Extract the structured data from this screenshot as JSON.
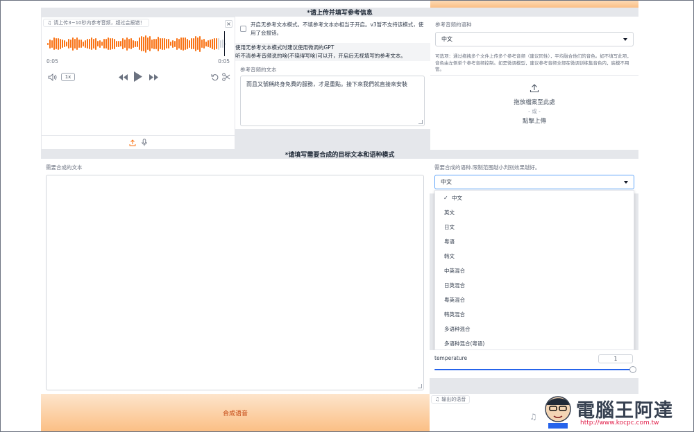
{
  "ref_section": {
    "title": "*请上传并填写参考信息"
  },
  "audio_upload": {
    "label": "请上传3~10秒内参考音频，超过会报错！",
    "time_start": "0:05",
    "time_end": "0:05",
    "speed": "1x"
  },
  "no_ref_mode": {
    "checkbox_label": "开启无参考文本模式。不填参考文本亦相当于开启。v3暂不支持该模式，使用了会报错。",
    "hint_line1": "使用无参考文本模式时建议使用微调的GPT",
    "hint_line2": "听不清参考音频说的啥(不晓得写啥)可以开，开启后无视填写的参考文本。"
  },
  "ref_text": {
    "label": "参考音频的文本",
    "value": "而且又號稱終身免費的服務，才是重點。接下來我們就直接來安裝"
  },
  "ref_lang": {
    "label": "参考音频的语种",
    "value": "中文",
    "hint": "可选项：通过拖拽多个文件上传多个参考音频（建议同性），平均融合他们的音色。如不填写此项，音色由左侧单个参考音频控制。如是微调模型，建议参考音频全部在微调训练集音色内，底模不用管。"
  },
  "file_drop": {
    "line1": "拖放檔案至此處",
    "line2": "- 或 -",
    "line3": "點擊上傳"
  },
  "target_section": {
    "title": "*请填写需要合成的目标文本和语种模式"
  },
  "target_text": {
    "label": "需要合成的文本",
    "value": ""
  },
  "target_lang": {
    "label": "需要合成的语种.限制范围越小判别效果越好。",
    "value": "中文",
    "check": "✓",
    "options": [
      "中文",
      "英文",
      "日文",
      "粤语",
      "韩文",
      "中英混合",
      "日英混合",
      "粤英混合",
      "韩英混合",
      "多语种混合",
      "多语种混合(粤语)"
    ]
  },
  "temperature": {
    "label": "temperature",
    "value": "1",
    "fraction": 1.0
  },
  "synthesize": {
    "label": "合成语音"
  },
  "output": {
    "label": "输出的语音"
  },
  "watermark": {
    "title": "電腦王阿達",
    "url": "http://www.kocpc.com.tw"
  },
  "colors": {
    "accent": "#f97316",
    "slider": "#2563eb",
    "gray_bg": "#e5e7eb"
  }
}
